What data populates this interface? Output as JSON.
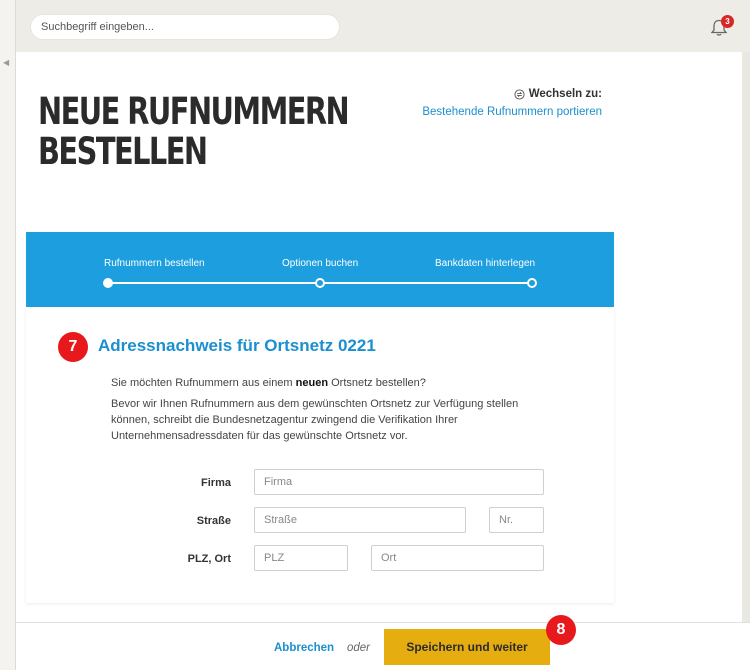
{
  "search": {
    "placeholder": "Suchbegriff eingeben..."
  },
  "notifications": {
    "count": "3"
  },
  "page": {
    "title": "NEUE RUFNUMMERN BESTELLEN",
    "switch_label": "Wechseln zu:",
    "switch_link": "Bestehende Rufnummern portieren"
  },
  "stepper": {
    "steps": [
      {
        "label": "Rufnummern bestellen",
        "state": "active"
      },
      {
        "label": "Optionen buchen",
        "state": "pending"
      },
      {
        "label": "Bankdaten hinterlegen",
        "state": "pending"
      }
    ]
  },
  "section": {
    "badge": "7",
    "title": "Adressnachweis für Ortsnetz 0221",
    "intro_before": "Sie möchten Rufnummern aus einem ",
    "intro_bold": "neuen",
    "intro_after": " Ortsnetz bestellen?",
    "description": "Bevor wir Ihnen Rufnummern aus dem gewünschten Ortsnetz zur Verfügung stellen können, schreibt die Bundesnetzagentur zwingend die Verifikation Ihrer Unternehmensadressdaten für das gewünschte Ortsnetz vor."
  },
  "form": {
    "firma": {
      "label": "Firma",
      "placeholder": "Firma",
      "value": ""
    },
    "strasse": {
      "label": "Straße",
      "placeholder": "Straße",
      "value": ""
    },
    "nr": {
      "placeholder": "Nr.",
      "value": ""
    },
    "plz_ort_label": "PLZ, Ort",
    "plz": {
      "placeholder": "PLZ",
      "value": ""
    },
    "ort": {
      "placeholder": "Ort",
      "value": ""
    }
  },
  "footer": {
    "cancel_label": "Abbrechen",
    "or_label": "oder",
    "save_label": "Speichern und weiter",
    "badge": "8"
  },
  "colors": {
    "accent": "#1d9ede",
    "link": "#1b8fcf",
    "primary_button": "#e6ad10",
    "badge_red": "#e8191d"
  },
  "icons": [
    "bell-icon",
    "swap-icon",
    "collapse-arrow-icon"
  ]
}
